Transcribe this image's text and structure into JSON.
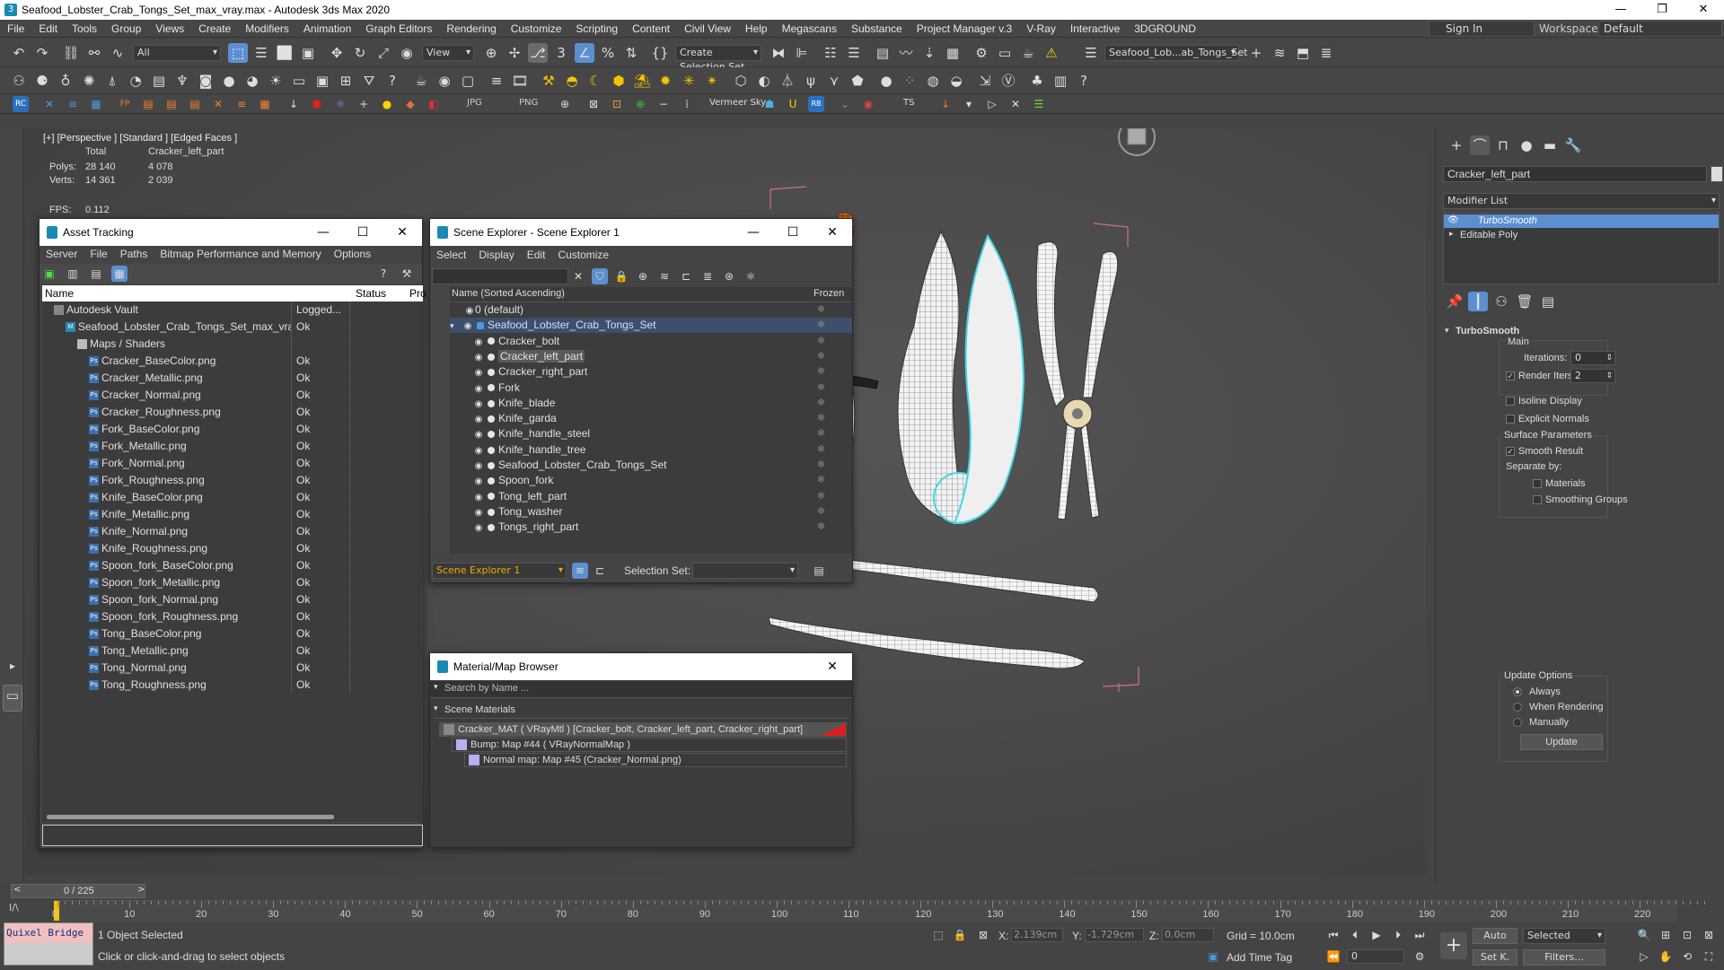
{
  "window": {
    "title": "Seafood_Lobster_Crab_Tongs_Set_max_vray.max - Autodesk 3ds Max 2020"
  },
  "menu": [
    "File",
    "Edit",
    "Tools",
    "Group",
    "Views",
    "Create",
    "Modifiers",
    "Animation",
    "Graph Editors",
    "Rendering",
    "Customize",
    "Scripting",
    "Content",
    "Civil View",
    "Help",
    "Megascans",
    "Substance",
    "Project Manager v.3",
    "V-Ray",
    "Interactive",
    "3DGROUND"
  ],
  "account": {
    "signin": "Sign In",
    "workspaces_label": "Workspaces:",
    "workspace": "Default"
  },
  "toolbar": {
    "filter": "All",
    "view": "View",
    "selection_set": "Create Selection Set",
    "scene_name": "Seafood_Lob...ab_Tongs_Set",
    "jpg": "JPG",
    "png": "PNG",
    "vermeer": "Vermeer Sky",
    "ts": "TS"
  },
  "viewport": {
    "label": "[+] [Perspective ] [Standard ] [Edged Faces ]",
    "stats": {
      "total_label": "Total",
      "object": "Cracker_left_part",
      "polys_label": "Polys:",
      "polys_total": "28 140",
      "polys_obj": "4 078",
      "verts_label": "Verts:",
      "verts_total": "14 361",
      "verts_obj": "2 039",
      "fps_label": "FPS:",
      "fps": "0.112"
    }
  },
  "asset_tracking": {
    "title": "Asset Tracking",
    "menu": [
      "Server",
      "File",
      "Paths",
      "Bitmap Performance and Memory",
      "Options"
    ],
    "cols": {
      "name": "Name",
      "status": "Status",
      "pro": "Pro"
    },
    "rows": [
      {
        "name": "Autodesk Vault",
        "status": "Logged...",
        "indent": 1,
        "type": "vault"
      },
      {
        "name": "Seafood_Lobster_Crab_Tongs_Set_max_vray.max",
        "status": "Ok",
        "indent": 2,
        "type": "max"
      },
      {
        "name": "Maps / Shaders",
        "status": "",
        "indent": 3,
        "type": "folder"
      },
      {
        "name": "Cracker_BaseColor.png",
        "status": "Ok",
        "indent": 4,
        "type": "ps"
      },
      {
        "name": "Cracker_Metallic.png",
        "status": "Ok",
        "indent": 4,
        "type": "ps"
      },
      {
        "name": "Cracker_Normal.png",
        "status": "Ok",
        "indent": 4,
        "type": "ps"
      },
      {
        "name": "Cracker_Roughness.png",
        "status": "Ok",
        "indent": 4,
        "type": "ps"
      },
      {
        "name": "Fork_BaseColor.png",
        "status": "Ok",
        "indent": 4,
        "type": "ps"
      },
      {
        "name": "Fork_Metallic.png",
        "status": "Ok",
        "indent": 4,
        "type": "ps"
      },
      {
        "name": "Fork_Normal.png",
        "status": "Ok",
        "indent": 4,
        "type": "ps"
      },
      {
        "name": "Fork_Roughness.png",
        "status": "Ok",
        "indent": 4,
        "type": "ps"
      },
      {
        "name": "Knife_BaseColor.png",
        "status": "Ok",
        "indent": 4,
        "type": "ps"
      },
      {
        "name": "Knife_Metallic.png",
        "status": "Ok",
        "indent": 4,
        "type": "ps"
      },
      {
        "name": "Knife_Normal.png",
        "status": "Ok",
        "indent": 4,
        "type": "ps"
      },
      {
        "name": "Knife_Roughness.png",
        "status": "Ok",
        "indent": 4,
        "type": "ps"
      },
      {
        "name": "Spoon_fork_BaseColor.png",
        "status": "Ok",
        "indent": 4,
        "type": "ps"
      },
      {
        "name": "Spoon_fork_Metallic.png",
        "status": "Ok",
        "indent": 4,
        "type": "ps"
      },
      {
        "name": "Spoon_fork_Normal.png",
        "status": "Ok",
        "indent": 4,
        "type": "ps"
      },
      {
        "name": "Spoon_fork_Roughness.png",
        "status": "Ok",
        "indent": 4,
        "type": "ps"
      },
      {
        "name": "Tong_BaseColor.png",
        "status": "Ok",
        "indent": 4,
        "type": "ps"
      },
      {
        "name": "Tong_Metallic.png",
        "status": "Ok",
        "indent": 4,
        "type": "ps"
      },
      {
        "name": "Tong_Normal.png",
        "status": "Ok",
        "indent": 4,
        "type": "ps"
      },
      {
        "name": "Tong_Roughness.png",
        "status": "Ok",
        "indent": 4,
        "type": "ps"
      }
    ]
  },
  "scene_explorer": {
    "title": "Scene Explorer - Scene Explorer 1",
    "menu": [
      "Select",
      "Display",
      "Edit",
      "Customize"
    ],
    "cols": {
      "name": "Name (Sorted Ascending)",
      "frozen": "Frozen"
    },
    "rows": [
      {
        "name": "0 (default)",
        "level": 0
      },
      {
        "name": "Seafood_Lobster_Crab_Tongs_Set",
        "level": 1,
        "selected": true
      },
      {
        "name": "Cracker_bolt",
        "level": 2
      },
      {
        "name": "Cracker_left_part",
        "level": 2,
        "highlight": true
      },
      {
        "name": "Cracker_right_part",
        "level": 2
      },
      {
        "name": "Fork",
        "level": 2
      },
      {
        "name": "Knife_blade",
        "level": 2
      },
      {
        "name": "Knife_garda",
        "level": 2
      },
      {
        "name": "Knife_handle_steel",
        "level": 2
      },
      {
        "name": "Knife_handle_tree",
        "level": 2
      },
      {
        "name": "Seafood_Lobster_Crab_Tongs_Set",
        "level": 2
      },
      {
        "name": "Spoon_fork",
        "level": 2
      },
      {
        "name": "Tong_left_part",
        "level": 2
      },
      {
        "name": "Tong_washer",
        "level": 2
      },
      {
        "name": "Tongs_right_part",
        "level": 2
      }
    ],
    "footer": {
      "explorer": "Scene Explorer 1",
      "selset_label": "Selection Set:"
    }
  },
  "material_browser": {
    "title": "Material/Map Browser",
    "search": "Search by Name ...",
    "section": "Scene Materials",
    "items": [
      {
        "text": "Cracker_MAT  ( VRayMtl ) [Cracker_bolt, Cracker_left_part, Cracker_right_part]",
        "level": 0
      },
      {
        "text": "Bump: Map #44  ( VRayNormalMap )",
        "level": 1
      },
      {
        "text": "Normal map: Map #45 (Cracker_Normal.png)",
        "level": 2
      }
    ]
  },
  "command_panel": {
    "object_name": "Cracker_left_part",
    "modifier_list": "Modifier List",
    "stack": [
      "TurboSmooth",
      "Editable Poly"
    ],
    "rollout": "TurboSmooth",
    "main": "Main",
    "iterations_label": "Iterations:",
    "iterations": "0",
    "render_iters_label": "Render Iters:",
    "render_iters": "2",
    "isoline": "Isoline Display",
    "explicit": "Explicit Normals",
    "surface": "Surface Parameters",
    "smooth_result": "Smooth Result",
    "separate": "Separate by:",
    "materials": "Materials",
    "smoothing": "Smoothing Groups",
    "update_options": "Update Options",
    "always": "Always",
    "when_rendering": "When Rendering",
    "manually": "Manually",
    "update": "Update"
  },
  "timeline": {
    "frame": "0 / 225",
    "ticks": [
      "0",
      "10",
      "20",
      "30",
      "40",
      "50",
      "60",
      "70",
      "80",
      "90",
      "100",
      "110",
      "120",
      "130",
      "140",
      "150",
      "160",
      "170",
      "180",
      "190",
      "200",
      "210",
      "220"
    ]
  },
  "status": {
    "quixel": "Quixel Bridge",
    "selected": "1 Object Selected",
    "hint": "Click or click-and-drag to select objects",
    "x_label": "X:",
    "x": "2.139cm",
    "y_label": "Y:",
    "y": "-1.729cm",
    "z_label": "Z:",
    "z": "0.0cm",
    "grid": "Grid = 10.0cm",
    "add_time_tag": "Add Time Tag",
    "auto": "Auto",
    "selected_dd": "Selected",
    "setk": "Set K.",
    "filters": "Filters...",
    "frame_field": "0"
  },
  "colors": {
    "selection": "#4a90d9",
    "highlight_cyan": "#40d8e8",
    "knife_handle": "#c85a1a",
    "bbox": "#d26aa0"
  }
}
